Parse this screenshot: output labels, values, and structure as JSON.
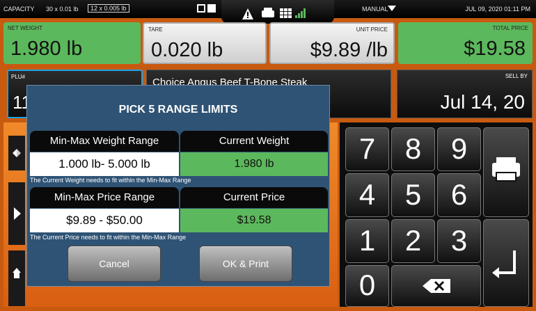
{
  "status_bar": {
    "capacity_label": "CAPACITY",
    "capacity_primary": "30 x 0.01 lb",
    "capacity_secondary": "12 x 0.005 lb",
    "mode": "MANUAL",
    "datetime": "JUL 09, 2020 01:11 PM"
  },
  "tiles": {
    "net_weight": {
      "label": "NET WEIGHT",
      "value": "1.980 lb"
    },
    "tare": {
      "label": "TARE",
      "value": "0.020 lb"
    },
    "unit_price": {
      "label": "UNIT PRICE",
      "value": "$9.89 /lb"
    },
    "total_price": {
      "label": "TOTAL PRICE",
      "value": "$19.58"
    },
    "plu": {
      "label": "PLU#",
      "value": "11"
    },
    "item_name": "Choice Angus Beef T-Bone Steak",
    "sell_by": {
      "label": "SELL BY",
      "value": "Jul 14, 20"
    }
  },
  "dialog": {
    "title": "PICK 5  RANGE LIMITS",
    "weight_range_header": "Min-Max Weight Range",
    "weight_range_value": "1.000 lb- 5.000 lb",
    "current_weight_header": "Current Weight",
    "current_weight_value": "1.980 lb",
    "weight_note": "The Current Weight needs to fit within the Min-Max Range",
    "price_range_header": "Min-Max Price Range",
    "price_range_value": "$9.89 - $50.00",
    "current_price_header": "Current Price",
    "current_price_value": "$19.58",
    "price_note": "The Current Price needs to fit within the Min-Max Range",
    "cancel_label": "Cancel",
    "ok_label": "OK & Print"
  },
  "keypad": {
    "keys": [
      "7",
      "8",
      "9",
      "4",
      "5",
      "6",
      "1",
      "2",
      "3",
      "0"
    ]
  },
  "colors": {
    "orange": "#e8761c",
    "green": "#5cb85c",
    "dialog_blue": "#2f5375"
  }
}
